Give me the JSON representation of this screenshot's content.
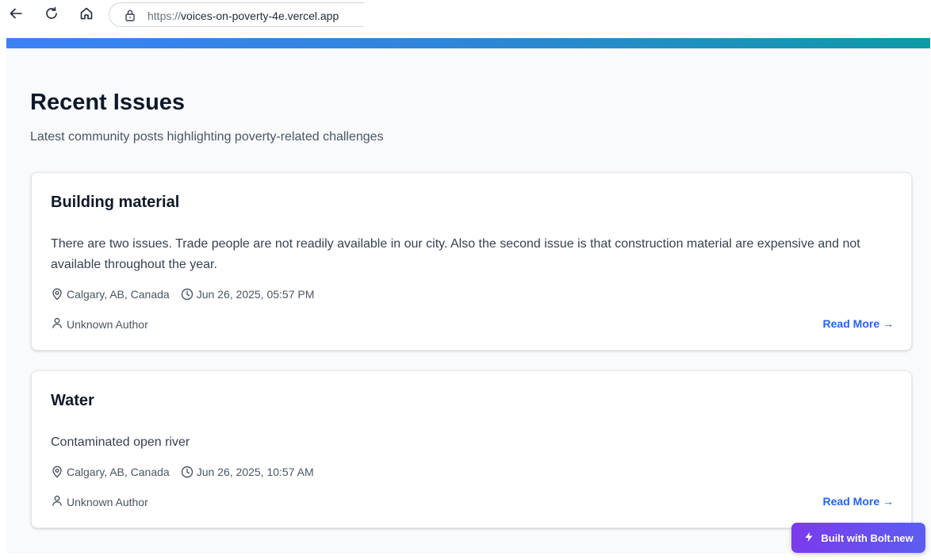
{
  "browser": {
    "url_scheme": "https://",
    "url_host": "voices-on-poverty-4e.vercel.app"
  },
  "page": {
    "title": "Recent Issues",
    "subtitle": "Latest community posts highlighting poverty-related challenges"
  },
  "issues": [
    {
      "title": "Building material",
      "description": "There are two issues. Trade people are not readily available in our city. Also the second issue is that construction material are expensive and not available throughout the year.",
      "location": "Calgary, AB, Canada",
      "datetime": "Jun 26, 2025, 05:57 PM",
      "author": "Unknown Author",
      "read_more": "Read More →"
    },
    {
      "title": "Water",
      "description": "Contaminated open river",
      "location": "Calgary, AB, Canada",
      "datetime": "Jun 26, 2025, 10:57 AM",
      "author": "Unknown Author",
      "read_more": "Read More →"
    }
  ],
  "badge": {
    "label": "Built with Bolt.new"
  },
  "colors": {
    "accent_link": "#2563eb",
    "gradient_start": "#3b82f6",
    "gradient_end": "#0e9aa7",
    "badge_start": "#7c3aed",
    "badge_end": "#5b5ef0"
  }
}
